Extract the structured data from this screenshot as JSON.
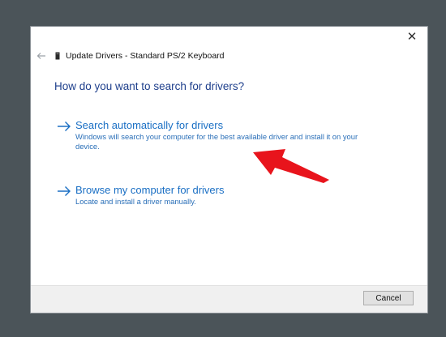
{
  "dialog": {
    "close_glyph": "✕",
    "title": "Update Drivers - Standard PS/2 Keyboard",
    "heading": "How do you want to search for drivers?",
    "options": [
      {
        "title": "Search automatically for drivers",
        "description": "Windows will search your computer for the best available driver and install it on your device."
      },
      {
        "title": "Browse my computer for drivers",
        "description": "Locate and install a driver manually."
      }
    ],
    "cancel_label": "Cancel"
  },
  "colors": {
    "background": "#4b5459",
    "heading": "#1e3f8c",
    "link": "#1a6fc4",
    "annotation_arrow": "#e8141c"
  },
  "icons": {
    "back": "back-arrow-icon",
    "device": "keyboard-device-icon",
    "option": "right-arrow-icon",
    "close": "close-icon"
  }
}
